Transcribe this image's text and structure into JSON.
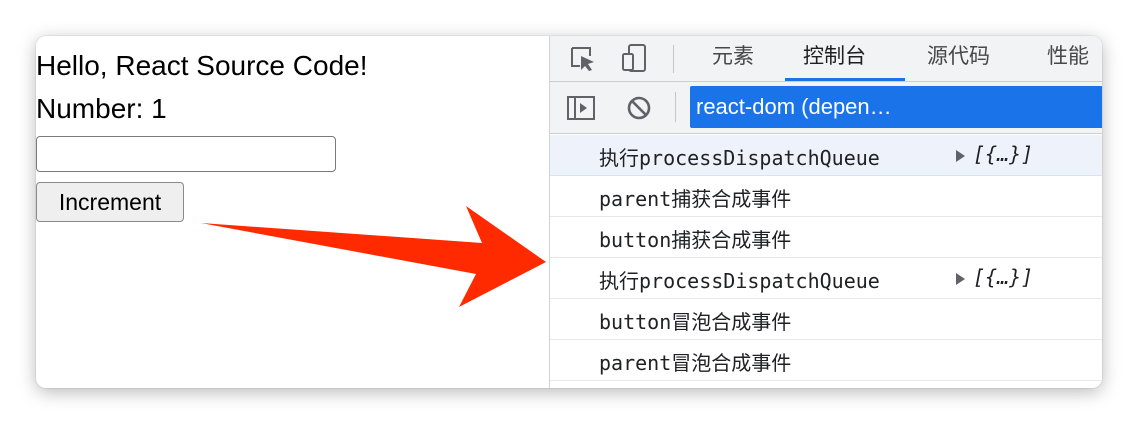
{
  "page": {
    "title": "Hello, React Source Code!",
    "number_text": "Number: 1",
    "input_value": "",
    "button_label": "Increment"
  },
  "devtools": {
    "tabs": [
      {
        "label": "元素",
        "active": false
      },
      {
        "label": "控制台",
        "active": true
      },
      {
        "label": "源代码",
        "active": false
      },
      {
        "label": "性能",
        "active": false
      }
    ],
    "toolbar_icons": [
      "inspect-element-icon",
      "device-toolbar-icon",
      "sidebar-toggle-icon",
      "clear-console-icon"
    ],
    "context_label": "react-dom (depen…",
    "logs": [
      {
        "text": "执行processDispatchQueue",
        "object": "[{…}]",
        "highlighted": true
      },
      {
        "text": "parent捕获合成事件",
        "highlighted": false
      },
      {
        "text": "button捕获合成事件",
        "highlighted": false
      },
      {
        "text": "执行processDispatchQueue",
        "object": "[{…}]",
        "highlighted": false
      },
      {
        "text": "button冒泡合成事件",
        "highlighted": false
      },
      {
        "text": "parent冒泡合成事件",
        "highlighted": false
      }
    ]
  },
  "colors": {
    "accent": "#1a73e8",
    "arrow": "#ff2a00",
    "devtools_bg": "#f1f3f4",
    "highlight_row": "#eef3fb"
  }
}
